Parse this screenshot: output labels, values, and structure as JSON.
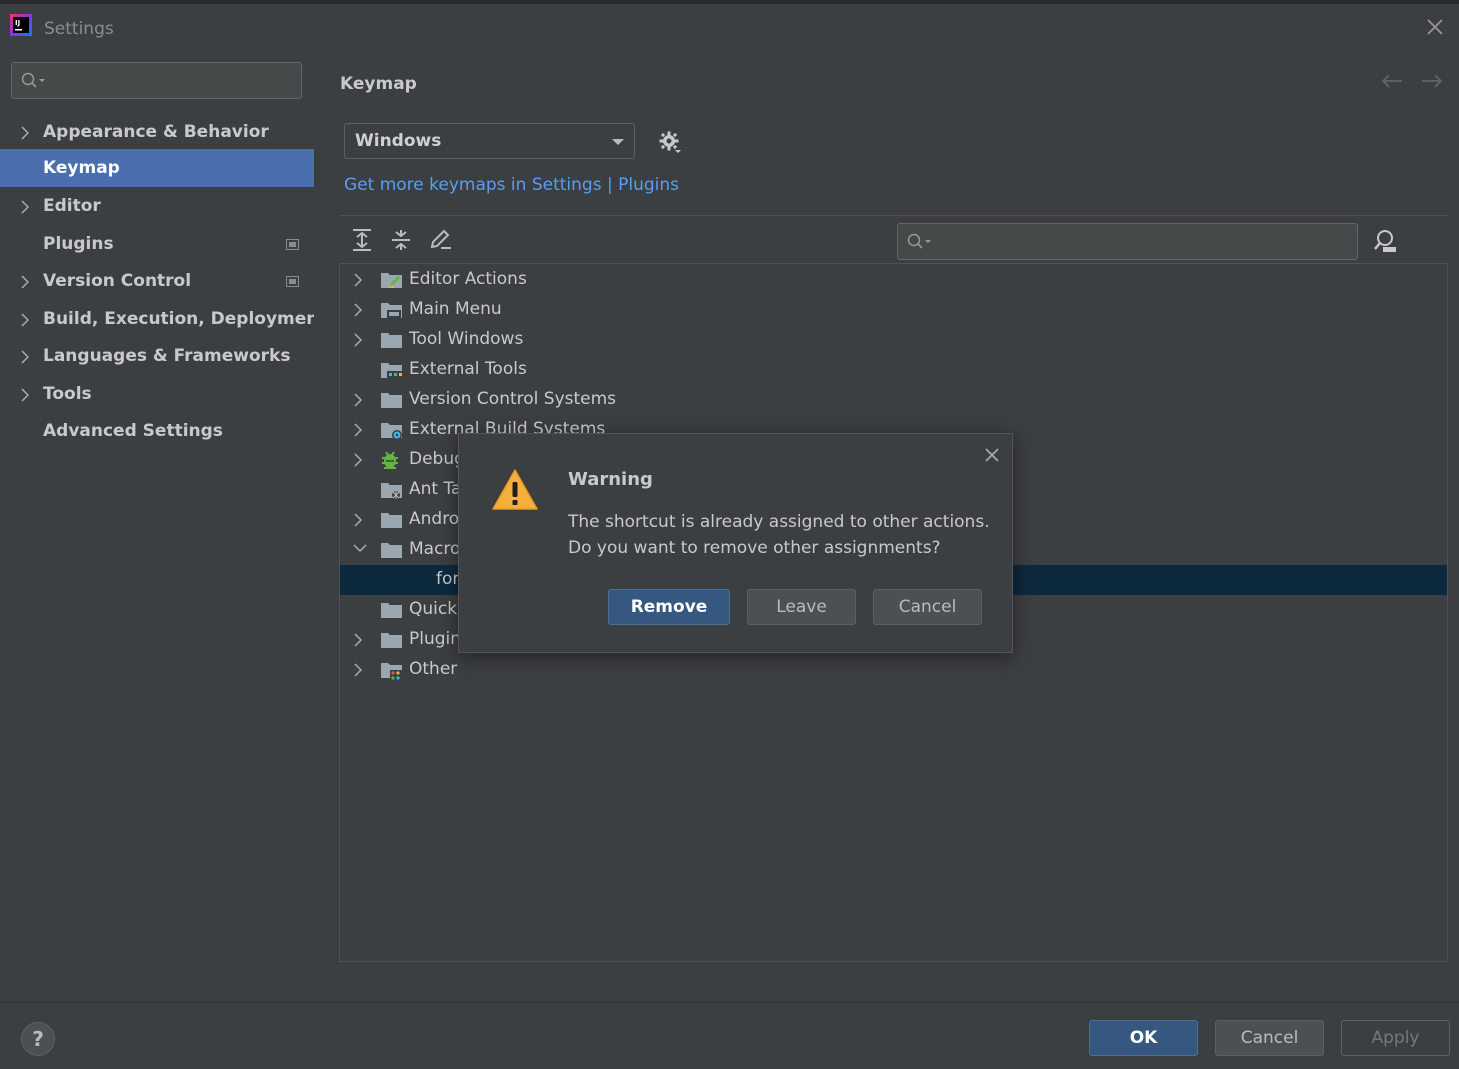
{
  "window": {
    "title": "Settings"
  },
  "sidebar": {
    "search_placeholder": "",
    "items": [
      {
        "label": "Appearance & Behavior",
        "expandable": true
      },
      {
        "label": "Keymap",
        "expandable": false,
        "selected": true
      },
      {
        "label": "Editor",
        "expandable": true
      },
      {
        "label": "Plugins",
        "expandable": false
      },
      {
        "label": "Version Control",
        "expandable": true
      },
      {
        "label": "Build, Execution, Deployment",
        "expandable": true
      },
      {
        "label": "Languages & Frameworks",
        "expandable": true
      },
      {
        "label": "Tools",
        "expandable": true
      },
      {
        "label": "Advanced Settings",
        "expandable": false
      }
    ]
  },
  "main": {
    "title": "Keymap",
    "keymap_selected": "Windows",
    "link_text": "Get more keymaps in Settings | Plugins",
    "search_placeholder": ""
  },
  "tree": {
    "rows": [
      {
        "label": "Editor Actions",
        "icon": "folder-edit-icon"
      },
      {
        "label": "Main Menu",
        "icon": "folder-menu-icon"
      },
      {
        "label": "Tool Windows",
        "icon": "folder-icon"
      },
      {
        "label": "External Tools",
        "icon": "folder-tools-icon"
      },
      {
        "label": "Version Control Systems",
        "icon": "folder-icon"
      },
      {
        "label": "External Build Systems",
        "icon": "folder-gear-icon"
      },
      {
        "label": "Debug",
        "icon": "bug-icon"
      },
      {
        "label": "Ant Ta",
        "icon": "folder-ant-icon"
      },
      {
        "label": "Andro",
        "icon": "folder-icon"
      },
      {
        "label": "Macro",
        "icon": "folder-icon"
      },
      {
        "label": "for",
        "icon": ""
      },
      {
        "label": "Quick",
        "icon": "folder-icon"
      },
      {
        "label": "Plugin",
        "icon": "folder-icon"
      },
      {
        "label": "Other",
        "icon": "folder-other-icon"
      }
    ]
  },
  "dialog": {
    "title": "Warning",
    "message_line1": "The shortcut is already assigned to other actions.",
    "message_line2": "Do you want to remove other assignments?",
    "remove_label": "Remove",
    "leave_label": "Leave",
    "cancel_label": "Cancel"
  },
  "footer": {
    "help_label": "?",
    "ok_label": "OK",
    "cancel_label": "Cancel",
    "apply_label": "Apply"
  },
  "colors": {
    "background": "#3c3f41",
    "selection": "#4b6eaf",
    "tree_selection": "#0d293e",
    "link": "#589df6",
    "primary_button": "#365880"
  }
}
